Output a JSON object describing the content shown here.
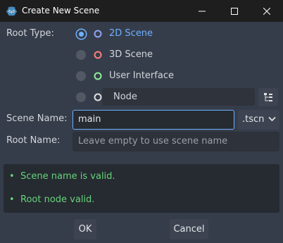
{
  "window": {
    "title": "Create New Scene"
  },
  "form": {
    "root_type_label": "Root Type:",
    "root_types": [
      {
        "label": "2D Scene",
        "icon": "node2d-icon",
        "selected": true
      },
      {
        "label": "3D Scene",
        "icon": "node3d-icon",
        "selected": false
      },
      {
        "label": "User Interface",
        "icon": "control-icon",
        "selected": false
      },
      {
        "label": "Node",
        "icon": "node-icon",
        "selected": false
      }
    ],
    "scene_name_label": "Scene Name:",
    "scene_name_value": "main",
    "extension_value": ".tscn",
    "root_name_label": "Root Name:",
    "root_name_placeholder": "Leave empty to use scene name"
  },
  "status": {
    "bullet": "•",
    "messages": [
      "Scene name is valid.",
      "Root node valid."
    ]
  },
  "buttons": {
    "ok": "OK",
    "cancel": "Cancel"
  },
  "colors": {
    "accent": "#6fb0ff",
    "node2d": "#8da5f3",
    "node3d": "#fc7f7f",
    "control": "#8eef97",
    "node": "#e0e0e0",
    "valid": "#65d47a"
  }
}
